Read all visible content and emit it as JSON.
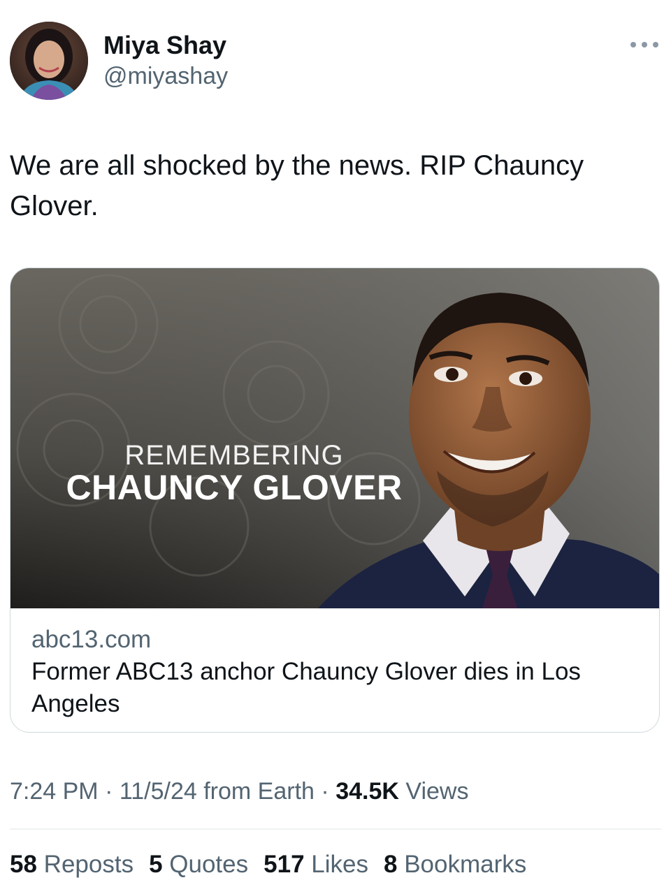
{
  "author": {
    "name": "Miya Shay",
    "handle": "@miyashay"
  },
  "tweet": {
    "text": "We are all shocked by the news. RIP Chauncy Glover."
  },
  "card": {
    "image_text_line1": "REMEMBERING",
    "image_text_line2": "CHAUNCY GLOVER",
    "domain": "abc13.com",
    "title": "Former ABC13 anchor Chauncy Glover dies in Los Angeles"
  },
  "meta": {
    "time": "7:24 PM",
    "separator": "·",
    "date": "11/5/24",
    "source": "from Earth",
    "views_count": "34.5K",
    "views_label": "Views"
  },
  "stats": {
    "reposts_count": "58",
    "reposts_label": "Reposts",
    "quotes_count": "5",
    "quotes_label": "Quotes",
    "likes_count": "517",
    "likes_label": "Likes",
    "bookmarks_count": "8",
    "bookmarks_label": "Bookmarks"
  },
  "icons": {
    "more": "more-horizontal-icon"
  },
  "colors": {
    "text_primary": "#0f1419",
    "text_secondary": "#536471",
    "border": "#cfd9de"
  }
}
